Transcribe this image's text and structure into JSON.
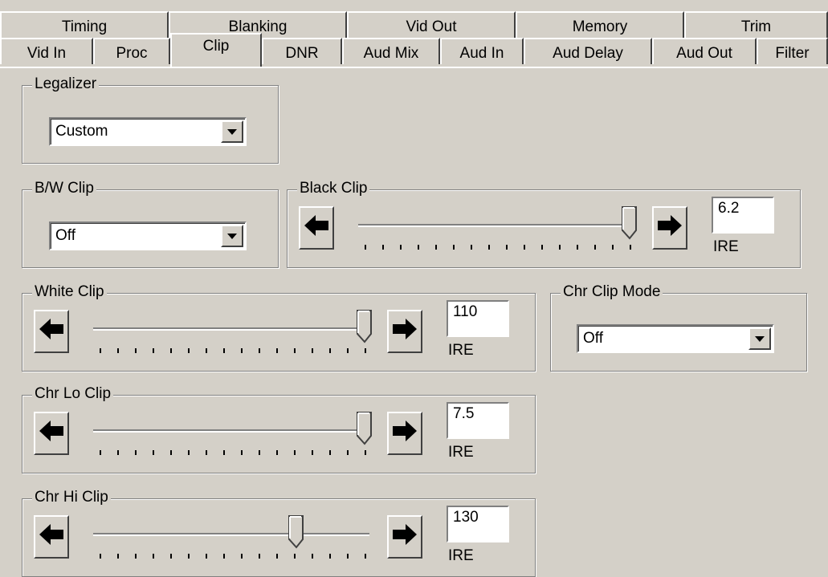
{
  "tabs_top": [
    "Timing",
    "Blanking",
    "Vid Out",
    "Memory",
    "Trim"
  ],
  "tabs_bottom": [
    "Vid In",
    "Proc",
    "Clip",
    "DNR",
    "Aud Mix",
    "Aud In",
    "Aud Delay",
    "Aud Out",
    "Filter"
  ],
  "active_tab": "Clip",
  "legalizer": {
    "label": "Legalizer",
    "value": "Custom"
  },
  "bw_clip": {
    "label": "B/W Clip",
    "value": "Off"
  },
  "chr_clip_mode": {
    "label": "Chr Clip Mode",
    "value": "Off"
  },
  "black_clip": {
    "label": "Black Clip",
    "value": "6.2",
    "unit": "IRE",
    "level": 1.0
  },
  "white_clip": {
    "label": "White Clip",
    "value": "110",
    "unit": "IRE",
    "level": 1.0
  },
  "chr_lo_clip": {
    "label": "Chr Lo Clip",
    "value": "7.5",
    "unit": "IRE",
    "level": 1.0
  },
  "chr_hi_clip": {
    "label": "Chr Hi Clip",
    "value": "130",
    "unit": "IRE",
    "level": 0.74
  },
  "icons": {
    "left": "left-arrow-icon",
    "right": "right-arrow-icon"
  }
}
